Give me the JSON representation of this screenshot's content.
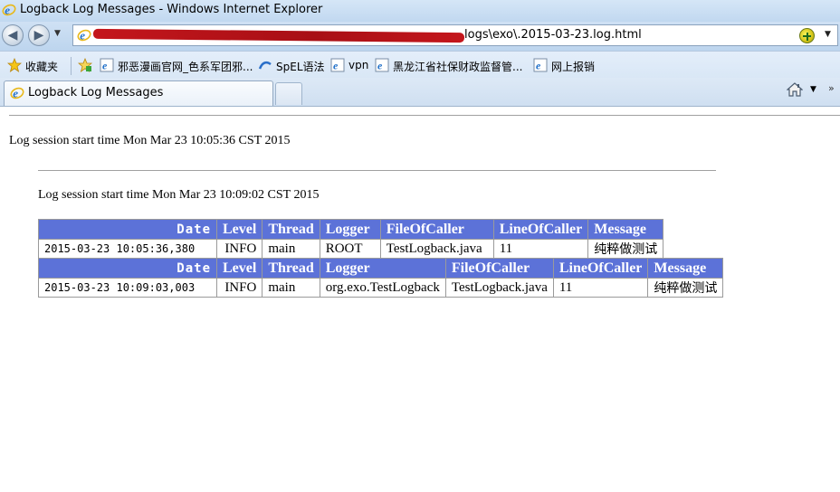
{
  "window": {
    "title": "Logback Log Messages - Windows Internet Explorer"
  },
  "address": {
    "url_visible": "logs\\exo\\.2015-03-23.log.html"
  },
  "favorites": {
    "label": "收藏夹",
    "items": [
      "邪恶漫画官网_色系军团邪...",
      "SpEL语法",
      "vpn",
      "黑龙江省社保财政监督管...",
      "网上报销"
    ]
  },
  "tabs": [
    {
      "label": "Logback Log Messages"
    }
  ],
  "page": {
    "session1": "Log session start time Mon Mar 23 10:05:36 CST 2015",
    "session2": "Log session start time Mon Mar 23 10:09:02 CST 2015",
    "headers": [
      "Date",
      "Level",
      "Thread",
      "Logger",
      "FileOfCaller",
      "LineOfCaller",
      "Message"
    ],
    "table1": [
      [
        "2015-03-23 10:05:36,380",
        "INFO",
        "main",
        "ROOT",
        "TestLogback.java",
        "11",
        "纯粹做测试"
      ]
    ],
    "table2": [
      [
        "2015-03-23 10:09:03,003",
        "INFO",
        "main",
        "org.exo.TestLogback",
        "TestLogback.java",
        "11",
        "纯粹做测试"
      ]
    ]
  }
}
